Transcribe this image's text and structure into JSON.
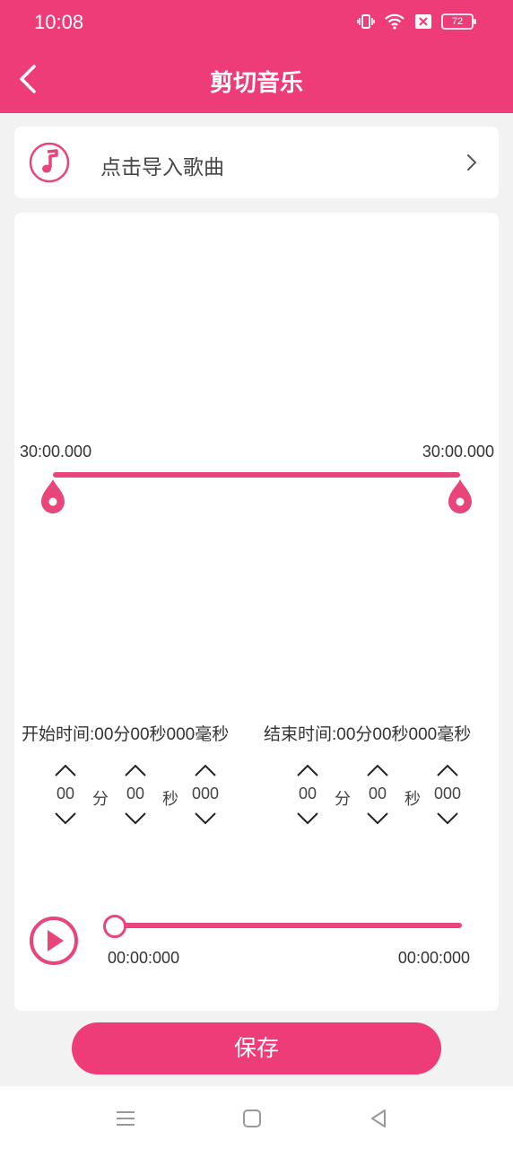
{
  "status_bar": {
    "time": "10:08",
    "battery": "72",
    "icons": [
      "vibrate-icon",
      "wifi-icon",
      "sim-blocked-icon",
      "battery-icon"
    ]
  },
  "app_bar": {
    "title": "剪切音乐",
    "back_icon": "chevron-left-icon"
  },
  "import": {
    "label": "点击导入歌曲",
    "icon": "music-note-icon",
    "arrow": "chevron-right-icon"
  },
  "range": {
    "start_label": "30:00.000",
    "end_label": "30:00.000"
  },
  "start_time": {
    "label": "开始时间:00分00秒000毫秒",
    "min": "00",
    "sec": "00",
    "ms": "000"
  },
  "end_time": {
    "label": "结束时间:00分00秒000毫秒",
    "min": "00",
    "sec": "00",
    "ms": "000"
  },
  "units": {
    "min": "分",
    "sec": "秒"
  },
  "player": {
    "current": "00:00:000",
    "total": "00:00:000",
    "progress": 0
  },
  "save_label": "保存",
  "colors": {
    "accent": "#ee3c78",
    "line": "#e8457a",
    "background": "#f2f2f2"
  }
}
